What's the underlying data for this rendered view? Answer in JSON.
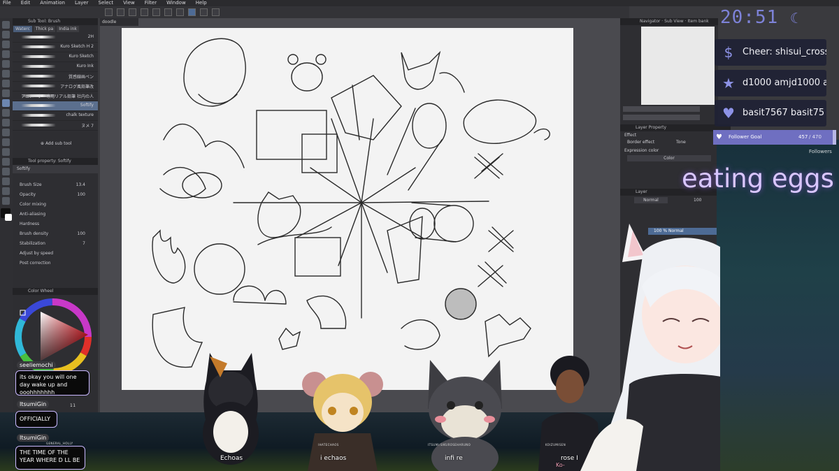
{
  "menu": [
    "File",
    "Edit",
    "Animation",
    "Layer",
    "Select",
    "View",
    "Filter",
    "Window",
    "Help"
  ],
  "subtool": {
    "header": "Sub Tool: Brush",
    "tabs": [
      "Waterc",
      "Thick pa",
      "India ink"
    ],
    "brushes": [
      "2H",
      "Kuro Sketch H 2",
      "Kuro Sketch",
      "Kuro Ink",
      "質感線画ペン",
      "アナログ風鉛筆改",
      "アニメーター専用リアル鉛筆 社内の人",
      "Softify",
      "chalk texture",
      "ヌメ 7"
    ],
    "selected_index": 7,
    "add_label": "Add sub tool"
  },
  "toolprop": {
    "header": "Tool property: Softify",
    "name": "Softify",
    "rows": [
      {
        "label": "Brush Size",
        "value": "13.4"
      },
      {
        "label": "Opacity",
        "value": "100"
      },
      {
        "label": "Color mixing",
        "value": ""
      },
      {
        "label": "Anti-aliasing",
        "value": ""
      },
      {
        "label": "Hardness",
        "value": ""
      },
      {
        "label": "Brush density",
        "value": "100"
      },
      {
        "label": "Stabilization",
        "value": "7"
      },
      {
        "label": "Adjust by speed",
        "value": ""
      },
      {
        "label": "Post correction",
        "value": ""
      }
    ]
  },
  "colorwheel": {
    "header": "Color Wheel"
  },
  "doc_tab": "doodle",
  "right": {
    "navigator": "Navigator",
    "sub_view": "Sub View",
    "item_bank": "Item bank",
    "layer_property": "Layer Property",
    "effect": "Effect",
    "border_effect": "Border effect",
    "tone": "Tone",
    "expression_color": "Expression color",
    "color": "Color",
    "layer_header": "Layer",
    "blend": "Normal",
    "opacity": "100",
    "layer_info": "100 % Normal"
  },
  "overlay": {
    "clock": "20:51",
    "alerts": [
      {
        "icon": "$",
        "text": "Cheer: shisui_cross"
      },
      {
        "icon": "★",
        "text": "d1000 amjd1000 a"
      },
      {
        "icon": "♥",
        "text": "basit7567 basit75"
      }
    ],
    "goal": {
      "label": "Follower Goal",
      "current": "457",
      "total": "/ 470 Followers",
      "progress": 0.972
    },
    "status": "eating eggs"
  },
  "chat": [
    {
      "name": "seeliemochi",
      "message": "its okay you will one day wake up and ooohhhhhhh"
    },
    {
      "name": "ItsumiGin",
      "message": "OFFICIALLY"
    },
    {
      "name": "ItsumiGin",
      "message": "THE TIME OF THE YEAR WHERE D   LL BE"
    }
  ],
  "avatars": [
    {
      "name": "Echoas",
      "tag": ""
    },
    {
      "name": "i   echaos",
      "tag": "IHATECHAOS"
    },
    {
      "name": "infi   re",
      "tag": "ITSUMI:SIKUROSEHARUNO"
    },
    {
      "name": "rose I",
      "tag": "KOIZUMISEN"
    }
  ],
  "misc": {
    "general_holly": "GENERAL_HOLLY",
    "ko": "Ko-",
    "page_indicator": "11"
  },
  "colors": {
    "accent": "#7d82d8",
    "chat_border": "#c9b8ff",
    "status": "#d9c6ff"
  }
}
